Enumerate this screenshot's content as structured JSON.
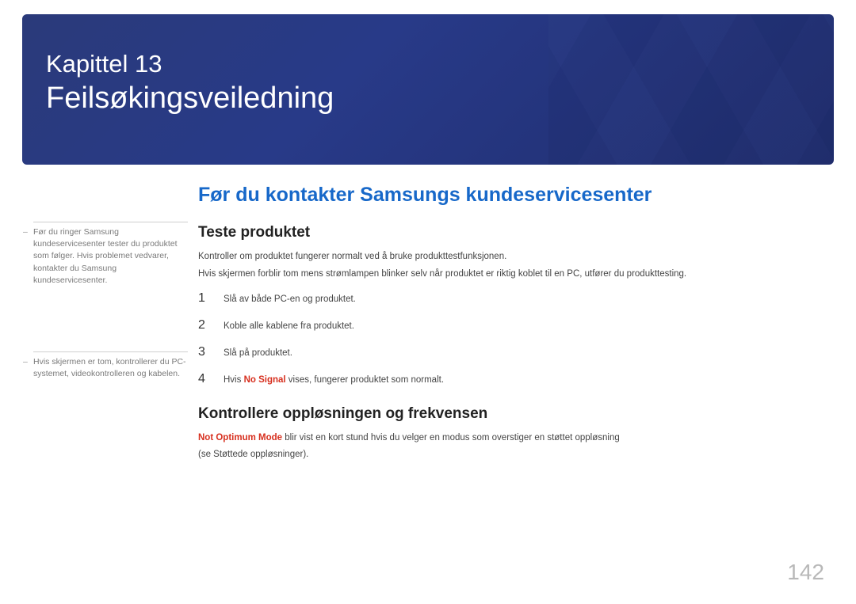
{
  "banner": {
    "chapter": "Kapittel 13",
    "title": "Feilsøkingsveiledning"
  },
  "sideNote1": "Før du ringer Samsung kundeservicesenter tester du produktet som følger. Hvis problemet vedvarer, kontakter du Samsung kundeservicesenter.",
  "sideNote2": "Hvis skjermen er tom, kontrollerer du PC-systemet, videokontrolleren og kabelen.",
  "main": {
    "heading": "Før du kontakter Samsungs kundeservicesenter",
    "section1": {
      "title": "Teste produktet",
      "intro1": "Kontroller om produktet fungerer normalt ved å bruke produkttestfunksjonen.",
      "intro2": "Hvis skjermen forblir tom mens strømlampen blinker selv når produktet er riktig koblet til en PC, utfører du produkttesting.",
      "steps": [
        "Slå av både PC-en og produktet.",
        "Koble alle kablene fra produktet.",
        "Slå på produktet."
      ],
      "step4pre": "Hvis ",
      "step4red": "No Signal",
      "step4post": " vises, fungerer produktet som normalt."
    },
    "section2": {
      "title": "Kontrollere oppløsningen og frekvensen",
      "line1red": "Not Optimum Mode",
      "line1rest": " blir vist en kort stund hvis du velger en modus som overstiger en støttet oppløsning",
      "line2": "(se Støttede oppløsninger)."
    }
  },
  "pageNumber": "142"
}
